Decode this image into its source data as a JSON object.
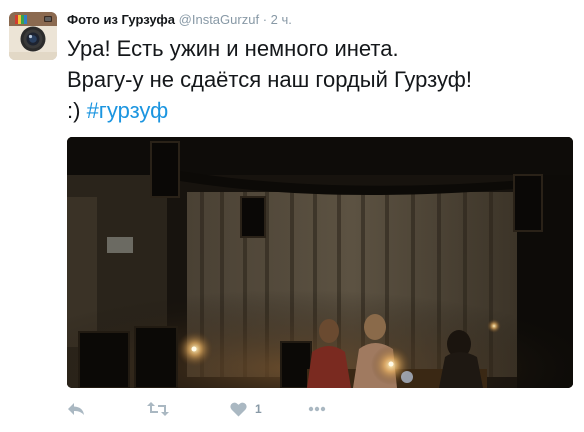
{
  "tweet": {
    "author_name": "Фото из Гурзуфа",
    "handle": "@InstaGurzuf",
    "separator": "·",
    "time": "2 ч.",
    "text_line1": "Ура! Есть ужин и немного инета.",
    "text_line2": "Врагу-у не сдаётся наш гордый Гурзуф!",
    "text_line3_prefix": ":) ",
    "hashtag": "#гурзуф"
  },
  "actions": {
    "reply_icon": "reply-icon",
    "retweet_icon": "retweet-icon",
    "like_icon": "heart-icon",
    "like_count": "1",
    "more_icon": "more-icon"
  },
  "colors": {
    "link": "#1b95e0",
    "muted": "#8899a6",
    "icon": "#aab8c2"
  }
}
